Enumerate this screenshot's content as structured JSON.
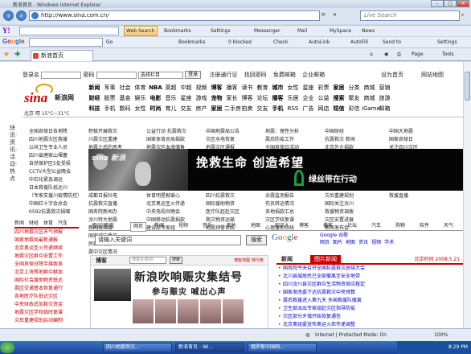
{
  "window": {
    "title": "新浪首页 - Windows Internet Explorer",
    "min": "–",
    "max": "□",
    "close": "✕"
  },
  "browser": {
    "url": "http://www.sina.com.cn/",
    "live_search_placeholder": "Live Search",
    "back_icon": "back-arrow-icon",
    "forward_icon": "forward-arrow-icon",
    "yahoo": {
      "logo": "Y!",
      "web_search": "Web Search",
      "bookmarks": "Bookmarks",
      "settings": "Settings",
      "messenger": "Messenger",
      "mail": "Mail",
      "myspace": "MySpace",
      "news": "News"
    },
    "google": {
      "logo": "Google",
      "go": "Go",
      "bookmarks": "Bookmarks",
      "blocked": "0 blocked",
      "check": "Check",
      "autolink": "AutoLink",
      "autofill": "AutoFill",
      "send_to": "Send to",
      "settings": "Settings"
    },
    "tab_label": "新浪首页",
    "page_menu": "Page",
    "tools_menu": "Tools"
  },
  "status": {
    "zone": "Internet | Protected Mode: On",
    "zoom": "100%"
  },
  "taskbar": {
    "tasks": [
      "四川地震受灾...",
      "新浪首页 - Wi...",
      "俄罗斯中国网..."
    ],
    "time": "8:29 PM"
  },
  "sina": {
    "login": {
      "user_label": "登录名",
      "pass_label": "密码",
      "select": "选择栏目",
      "login_btn": "登录",
      "links": [
        "注册通行证",
        "找回密码",
        "免费邮箱",
        "企业邮箱"
      ],
      "right": [
        "设为首页",
        "网站地图"
      ]
    },
    "logo": {
      "sina": "sina",
      "cn": "新浪网",
      "sub": "北京 晴 15°C~31°C"
    },
    "nav": [
      [
        "新闻",
        "军事",
        "社会",
        "体育",
        "NBA",
        "英超",
        "中超",
        "视频",
        "博客",
        "播客",
        "读书",
        "教育",
        "城市",
        "女性",
        "星座",
        "彩票",
        "家居",
        "分类",
        "商城",
        "营销"
      ],
      [
        "财经",
        "股票",
        "基金",
        "娱乐",
        "电影",
        "音乐",
        "星座",
        "游戏",
        "宠物",
        "家长",
        "博客",
        "论坛",
        "播客",
        "乐居",
        "企业",
        "公益",
        "搜索",
        "聚友",
        "商城",
        "旅游"
      ],
      [
        "科技",
        "手机",
        "数码",
        "女性",
        "时尚",
        "育儿",
        "交友",
        "房产",
        "家居",
        "二手房",
        "拍卖",
        "交友",
        "手机",
        "RSS",
        "广告",
        "网店",
        "短信",
        "彩信",
        "iGame",
        "邮箱"
      ]
    ],
    "left_vertical": "快讯·资讯·活动·热点",
    "col1": [
      "全国哀悼日各地降",
      "四川地震灾区救援",
      "公共卫生专业人员",
      "四川省唐家山堰塞",
      "自然保护区5处受损",
      "CCTV大型公益晚会",
      "中石化紧急调运",
      "日本救援队抵达川",
      "（专家支援川疫情防控）",
      "中国红十字会总会",
      "0592抗震救灾捐赠"
    ],
    "col2": [
      "积极开展救灾",
      "川震灾区重建",
      "地震之后的思考",
      "成都日报社电",
      "抗震救灾直播",
      "国务院新闻办",
      "汶川特大地震",
      "新闻发布会",
      "国家减灾委员",
      "民政部最新",
      "震中灾区情况"
    ],
    "col3": [
      "公益行动 抗震救灾",
      "国家体育总局捐款",
      "地震灾区血液储备",
      "体育明星献爱心",
      "北京奥运圣火传递",
      "中央电视台晚会",
      "中国移动抗震捐款",
      "建设部专家组"
    ],
    "col4": [
      "中国地震局公告",
      "灾区水电恢复",
      "地震灾区通报",
      "四川抗震救灾",
      "国际援助物资",
      "医疗队赶赴灾区",
      "救灾物资运输",
      "地震预警系统"
    ],
    "col5": [
      "地震：理性分析",
      "震后防疫工作",
      "全国哀悼日活动",
      "余震监测报告",
      "伤员转运情况",
      "各地捐款汇总",
      "灾区学校复课",
      "心理援助热线"
    ],
    "col6": [
      "中国财经",
      "抗震救灾 新闻",
      "北京外企捐款",
      "灾后重建规划",
      "国际关注汶川",
      "救援物资调拨",
      "灾区安置进展",
      "新闻发布会"
    ],
    "col7": [
      "中国大地震",
      "国家哀悼日",
      "关注四川灾区",
      "抗震一线报道",
      "地震专家解读",
      "抗震救灾英雄",
      "全国捐款统计",
      "灾区最新消息",
      "救援直播"
    ],
    "banner": {
      "watermark": "sina 新浪",
      "slogan": "挽救生命 创造希望",
      "sub": "绿丝带在行动"
    },
    "lower_tabs": [
      "新闻",
      "财经",
      "体育",
      "汽车"
    ],
    "lower_list": [
      "四川地震灾区天气预报",
      "国家地震局最新通报",
      "北京奥运圣火传递继续",
      "地震灾区群众安置工作",
      "全国哀悼日降半旗致哀",
      "北京上海等地群众献血",
      "国际社会援助物资抵达",
      "震区交通基本恢复通行",
      "各地医疗队抵达灾区",
      "中央财政追加救灾资金",
      "地震灾区学校临时复课",
      "灾后重建规划启动编制"
    ],
    "search": {
      "label": "爱问搜索",
      "tabs": [
        "网页",
        "新闻",
        "视频",
        "音乐",
        "图片",
        "地图",
        "知识人",
        "博客",
        "播客",
        "论坛",
        "汽车",
        "购物",
        "软件",
        "天气"
      ],
      "placeholder": "请输入关键词",
      "btn": "搜索",
      "google_text": "Google 谷歌",
      "google_links": [
        "网页",
        "图片",
        "地图",
        "资讯",
        "视频",
        "学术"
      ]
    },
    "blog": {
      "title": "博客",
      "input_placeholder": "博客名/昵称",
      "btn": "搜索",
      "right": "博客地图 排行榜"
    },
    "disaster": {
      "t1": "新浪吹响赈灾集结号",
      "t2": "参与赈灾 喊出心声"
    },
    "news": {
      "title": "新闻",
      "tab_active": "图片新闻",
      "date": "北京时间 2008.5.21",
      "items": [
        "国务院今天召开全国抗震救灾总结大会",
        "北川县城居民已全部撤离至安全地带",
        "四川汶川县灾区群众生活物资供应稳定",
        "国家发改委下达抗震救灾中央预算",
        "震后救援进入第九天 多国救援队撤离",
        "卫生部派出专家组赴灾区指导防疫",
        "灾区部分乡镇开始恢复通信",
        "北京奥组委宣布奥运火炬传递调整",
        "中国红十字会公布最新捐款数额"
      ]
    }
  }
}
